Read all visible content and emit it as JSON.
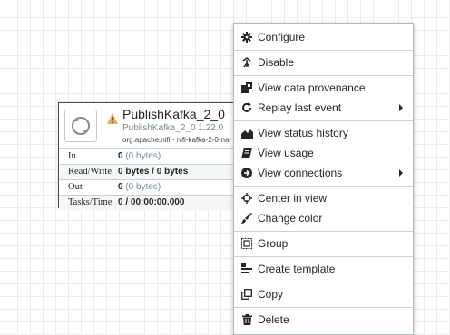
{
  "processor": {
    "name": "PublishKafka_2_0",
    "type": "PublishKafka_2_0 1.22.0",
    "bundle": "org.apache.nifi - nifi-kafka-2-0-nar",
    "stats": [
      {
        "label": "In",
        "value": "0",
        "detail": "(0 bytes)"
      },
      {
        "label": "Read/Write",
        "value": "0 bytes / 0 bytes",
        "detail": ""
      },
      {
        "label": "Out",
        "value": "0",
        "detail": "(0 bytes)"
      },
      {
        "label": "Tasks/Time",
        "value": "0 / 00:00:00.000",
        "detail": ""
      }
    ]
  },
  "menu": {
    "configure": "Configure",
    "disable": "Disable",
    "view_provenance": "View data provenance",
    "replay": "Replay last event",
    "view_status_history": "View status history",
    "view_usage": "View usage",
    "view_connections": "View connections",
    "center_in_view": "Center in view",
    "change_color": "Change color",
    "group": "Group",
    "create_template": "Create template",
    "copy": "Copy",
    "delete": "Delete"
  },
  "colors": {
    "warning": "#f0ad4e",
    "grid": "#ececec",
    "processor_type": "#728e9b"
  }
}
